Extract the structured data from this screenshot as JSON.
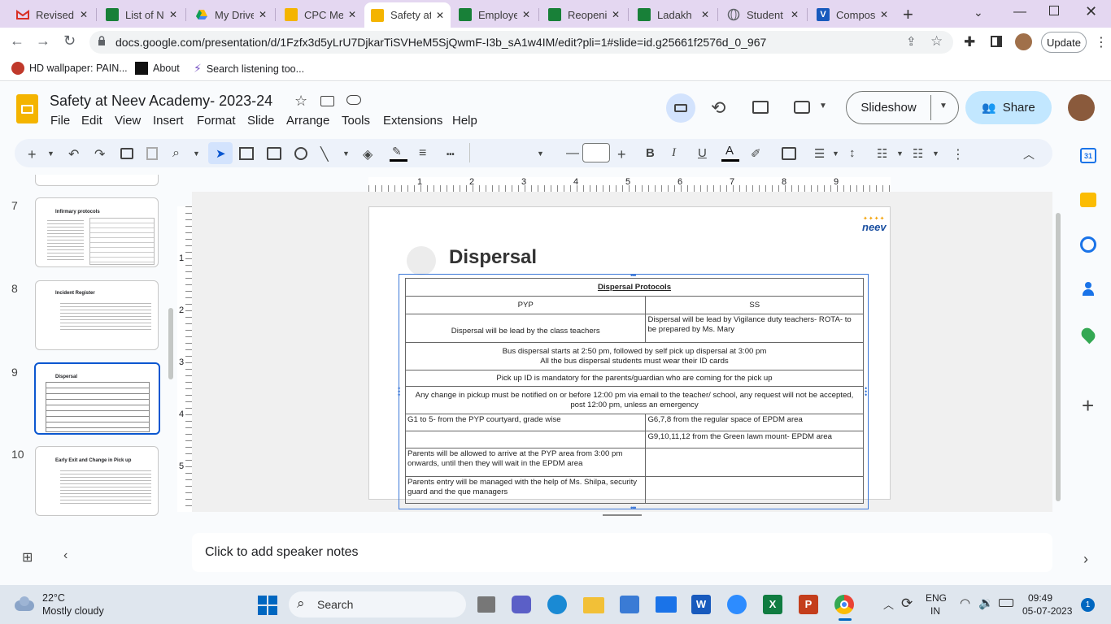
{
  "browser": {
    "tabs": [
      {
        "title": "Revised",
        "icon": "gmail-icon",
        "color": "#d93025"
      },
      {
        "title": "List of N",
        "icon": "sheets-icon",
        "color": "#188038"
      },
      {
        "title": "My Drive",
        "icon": "drive-icon",
        "color": "#fbbc04"
      },
      {
        "title": "CPC Me",
        "icon": "slides-icon",
        "color": "#f4b400"
      },
      {
        "title": "Safety at",
        "icon": "slides-icon",
        "color": "#f4b400",
        "active": true
      },
      {
        "title": "Employe",
        "icon": "sheets-icon",
        "color": "#188038"
      },
      {
        "title": "Reopeni",
        "icon": "sheets-icon",
        "color": "#188038"
      },
      {
        "title": "Ladakh",
        "icon": "sheets-icon",
        "color": "#188038"
      },
      {
        "title": "Student",
        "icon": "globe-icon",
        "color": "#5f6368"
      },
      {
        "title": "Compos",
        "icon": "word-icon",
        "color": "#185abd"
      }
    ],
    "url": "docs.google.com/presentation/d/1Fzfx3d5yLrU7DjkarTiSVHeM5SjQwmF-I3b_sA1w4IM/edit?pli=1#slide=id.g25661f2576d_0_967",
    "update_label": "Update",
    "bookmarks": [
      {
        "label": "HD wallpaper: PAIN..."
      },
      {
        "label": "About"
      },
      {
        "label": "Search listening too..."
      }
    ]
  },
  "doc": {
    "title": "Safety at Neev Academy- 2023-24",
    "menu": [
      "File",
      "Edit",
      "View",
      "Insert",
      "Format",
      "Slide",
      "Arrange",
      "Tools",
      "Extensions",
      "Help"
    ],
    "slideshow_label": "Slideshow",
    "share_label": "Share",
    "notes_placeholder": "Click to add speaker notes",
    "ruler_h": [
      "1",
      "2",
      "3",
      "4",
      "5",
      "6",
      "7",
      "8",
      "9"
    ],
    "ruler_v": [
      "1",
      "2",
      "3",
      "4",
      "5"
    ]
  },
  "filmstrip": [
    {
      "num": "7",
      "title": "Infirmary protocols"
    },
    {
      "num": "8",
      "title": "Incident Register"
    },
    {
      "num": "9",
      "title": "Dispersal",
      "selected": true
    },
    {
      "num": "10",
      "title": "Early Exit and Change in Pick up"
    }
  ],
  "slide": {
    "heading": "Dispersal",
    "logo_text": "neev",
    "table_title": "Dispersal Protocols",
    "col1": "PYP",
    "col2": "SS",
    "r1c1": "Dispersal will be lead by the class teachers",
    "r1c2": "Dispersal will be lead by Vigilance duty teachers- ROTA- to be prepared by Ms. Mary",
    "r2a": "Bus dispersal starts at 2:50 pm, followed by self pick up dispersal at 3:00 pm",
    "r2b": "All the bus dispersal students must wear their ID cards",
    "r3": "Pick up ID is mandatory for the parents/guardian who are coming for the pick up",
    "r4": "Any change in pickup must be notified on or before 12:00 pm via email to the teacher/ school, any request  will not be accepted, post 12:00 pm, unless an emergency",
    "r5c1": "G1 to 5- from the PYP courtyard, grade wise",
    "r5c2": "G6,7,8 from the regular space of EPDM area",
    "r6c2": "G9,10,11,12 from the Green lawn mount- EPDM area",
    "r7c1": "Parents will be allowed to arrive at the PYP area from 3:00 pm onwards, until then they will wait in the EPDM area",
    "r8c1": "Parents entry will be managed with the help of Ms. Shilpa, security guard and the que managers"
  },
  "taskbar": {
    "temp": "22°C",
    "weather": "Mostly cloudy",
    "search": "Search",
    "lang1": "ENG",
    "lang2": "IN",
    "time": "09:49",
    "date": "05-07-2023",
    "badge": "1"
  }
}
